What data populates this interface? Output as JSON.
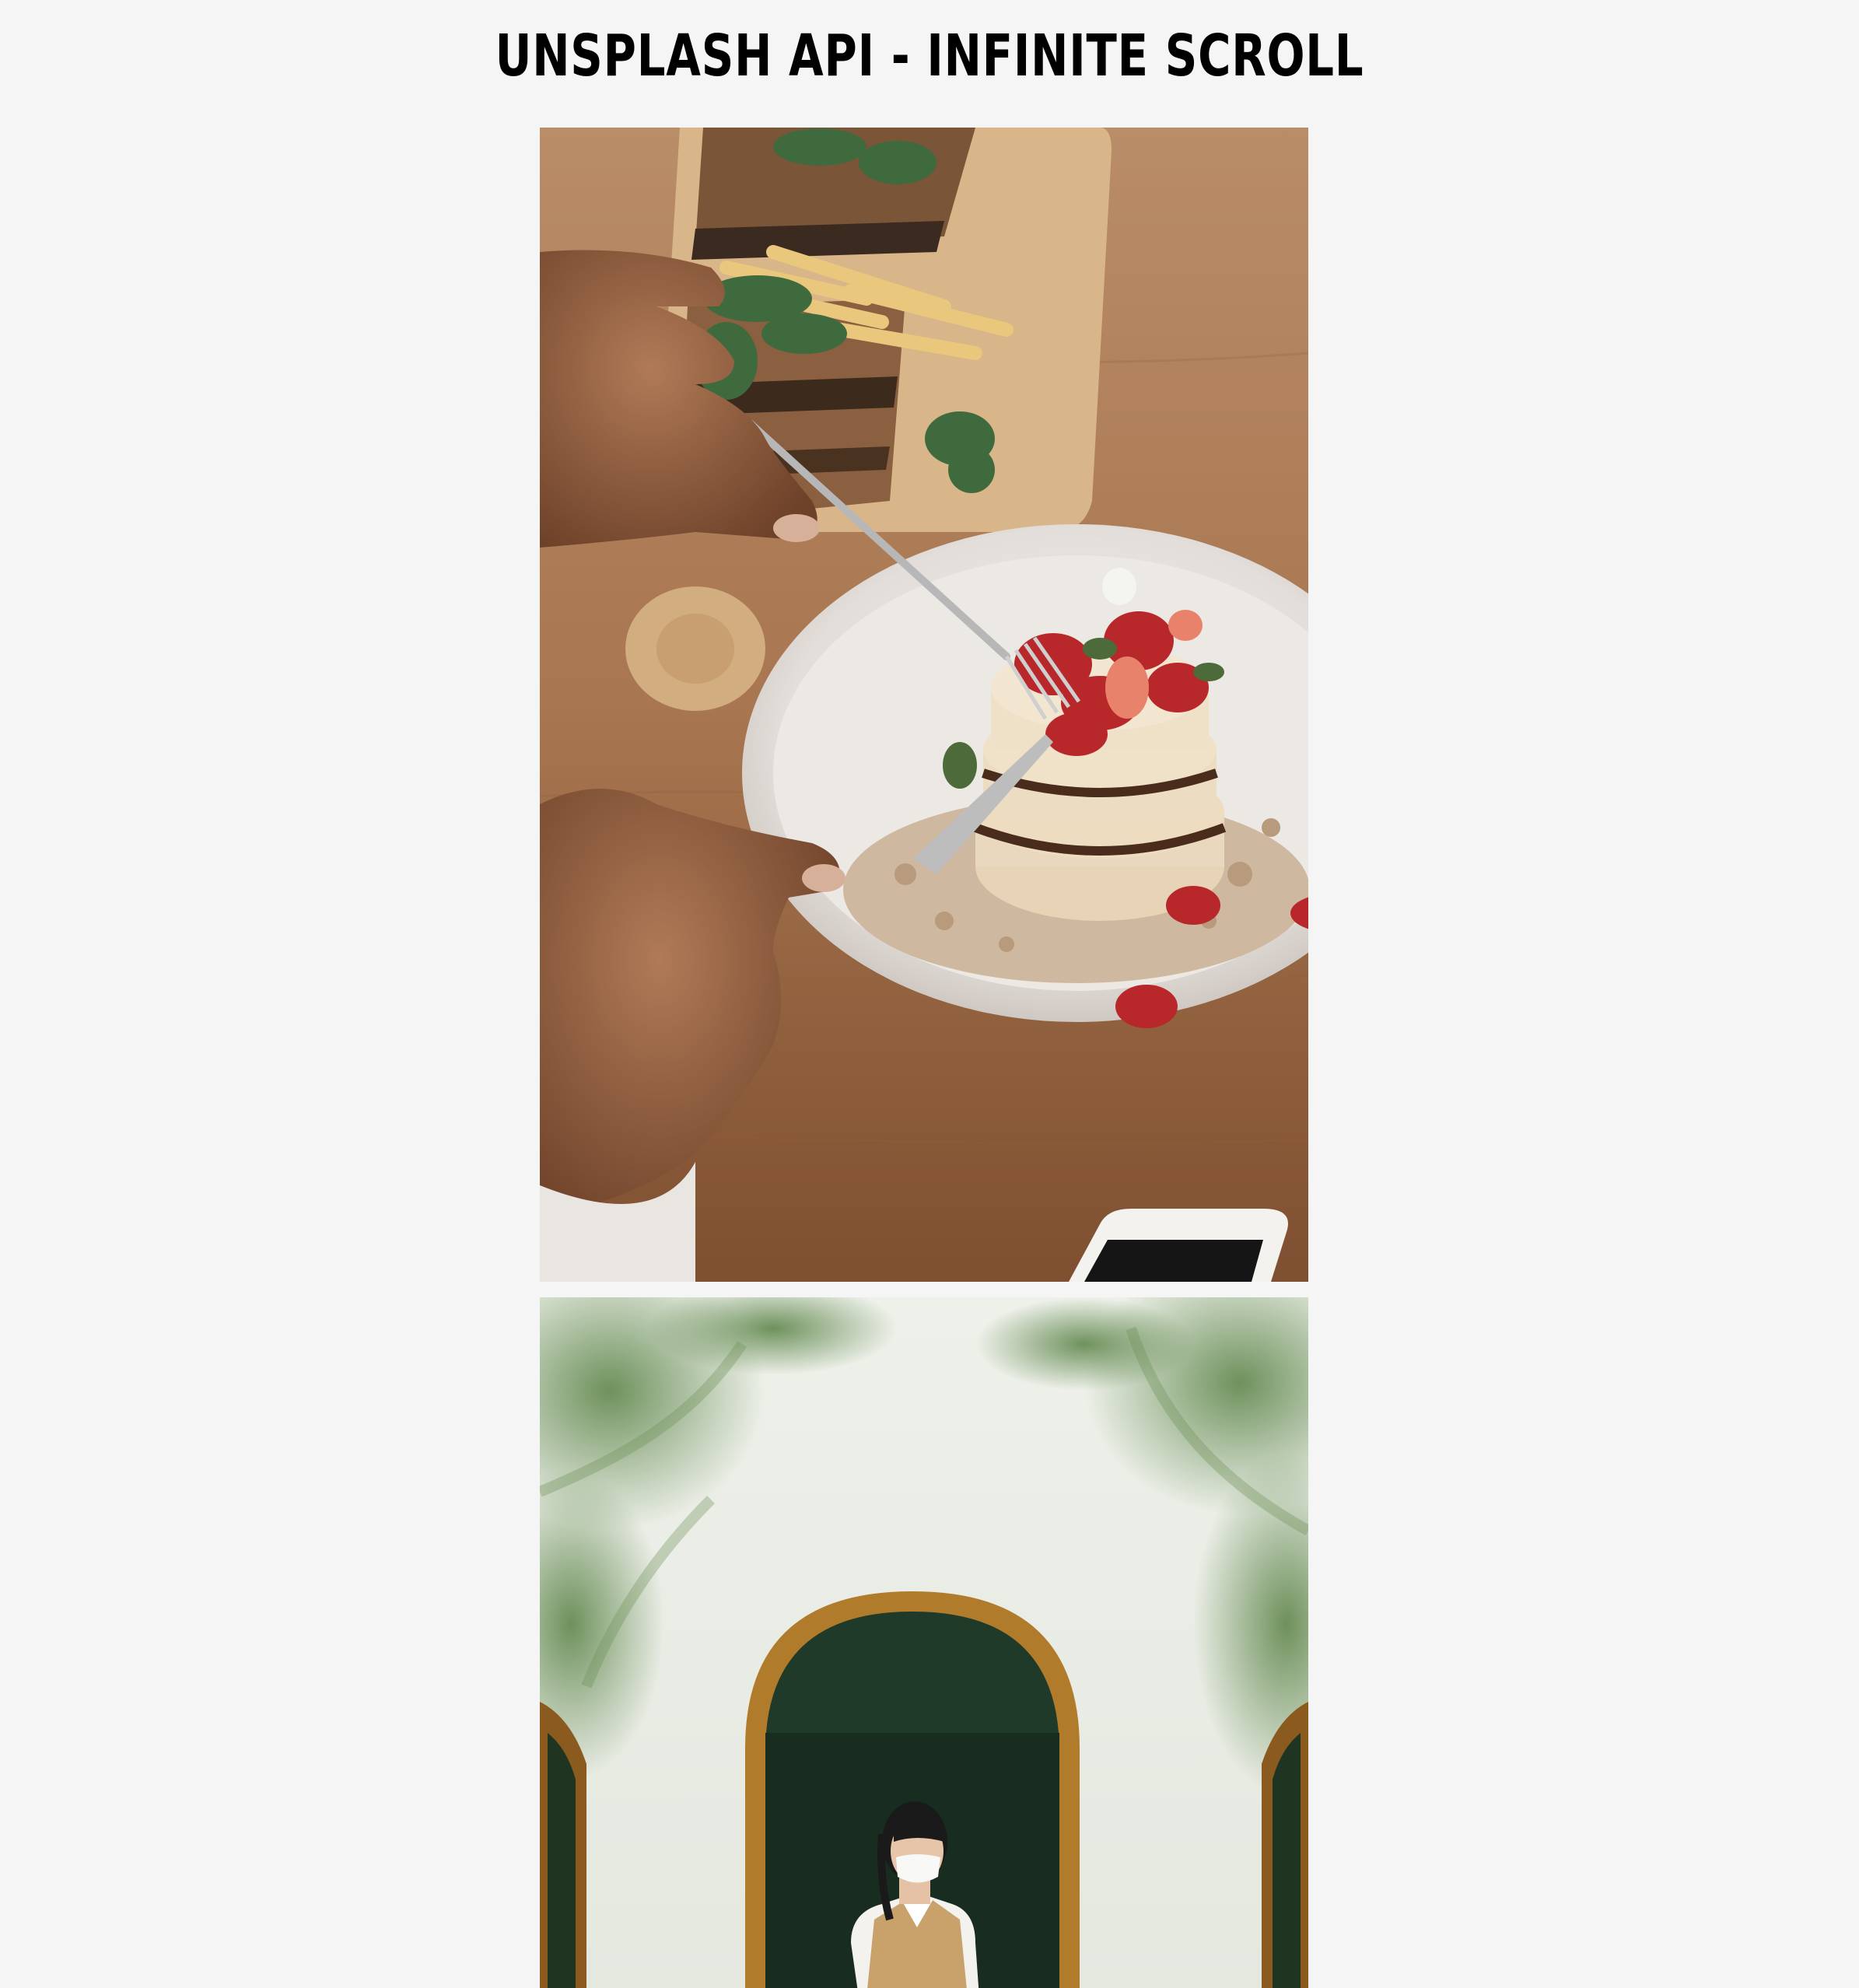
{
  "page": {
    "title": "Unsplash API - Infinite Scroll"
  },
  "images": [
    {
      "subject": "pancake-stack-with-strawberries-photo"
    },
    {
      "subject": "woman-in-arched-doorway-photo"
    }
  ],
  "colors": {
    "background": "#f5f5f5",
    "title": "#000000"
  }
}
